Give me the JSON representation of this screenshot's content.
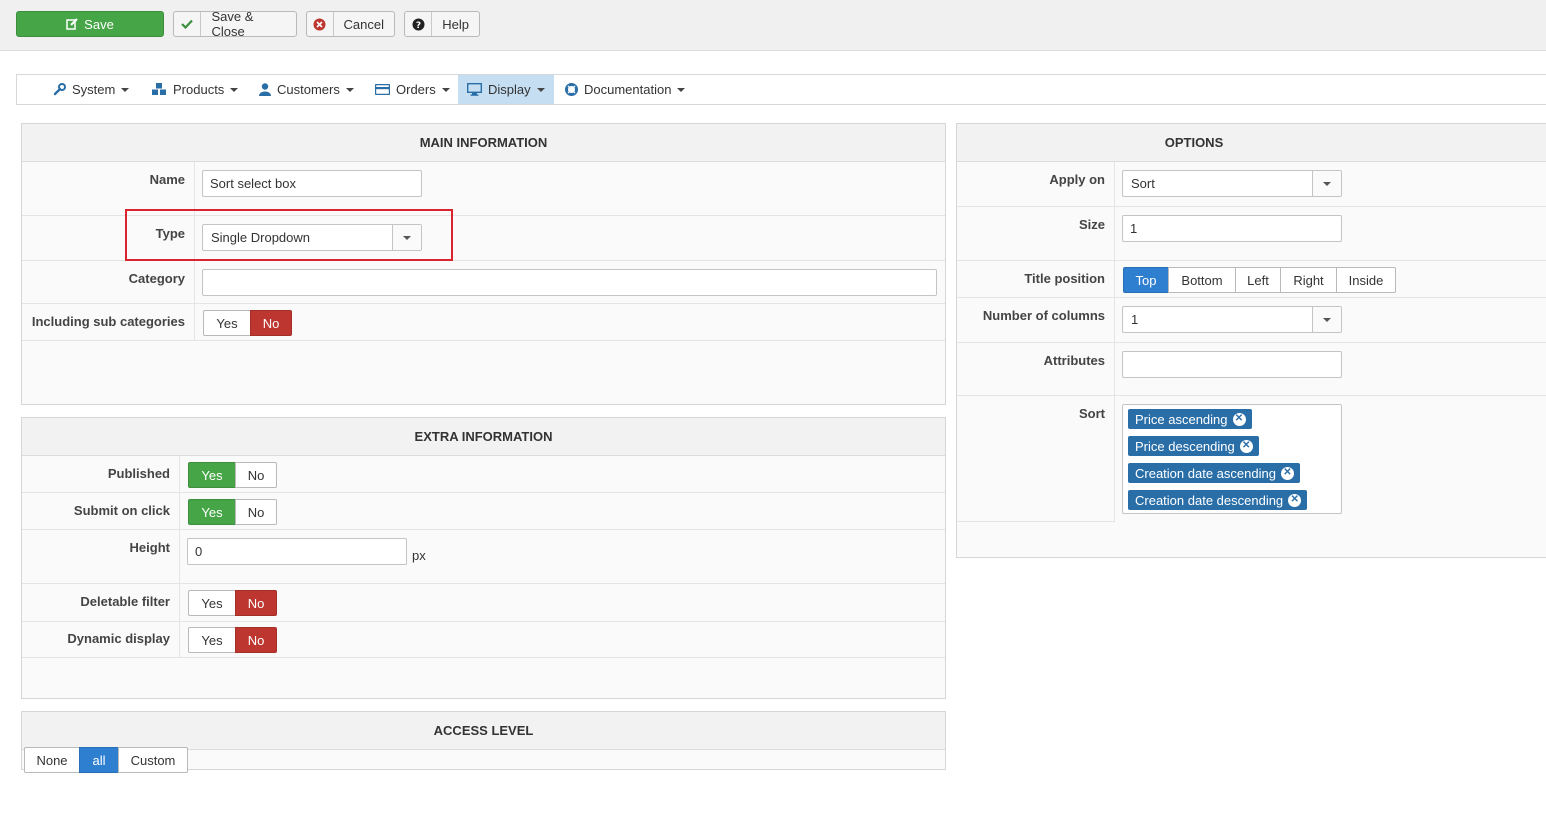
{
  "toolbar": {
    "save": "Save",
    "save_close": "Save & Close",
    "cancel": "Cancel",
    "help": "Help"
  },
  "nav": {
    "items": [
      "System",
      "Products",
      "Customers",
      "Orders",
      "Display",
      "Documentation"
    ],
    "active": "Display"
  },
  "main": {
    "title": "MAIN INFORMATION",
    "name_label": "Name",
    "name_value": "Sort select box",
    "type_label": "Type",
    "type_value": "Single Dropdown",
    "category_label": "Category",
    "category_value": "",
    "subcat_label": "Including sub categories",
    "subcat_yes": "Yes",
    "subcat_no": "No",
    "subcat_selected": "No"
  },
  "extra": {
    "title": "EXTRA INFORMATION",
    "published_label": "Published",
    "submit_label": "Submit on click",
    "height_label": "Height",
    "height_value": "0",
    "height_unit": "px",
    "deletable_label": "Deletable filter",
    "dynamic_label": "Dynamic display",
    "yes": "Yes",
    "no": "No",
    "published_selected": "Yes",
    "submit_selected": "Yes",
    "deletable_selected": "No",
    "dynamic_selected": "No"
  },
  "access": {
    "title": "ACCESS LEVEL",
    "options": [
      "None",
      "all",
      "Custom"
    ],
    "selected": "all"
  },
  "options": {
    "title": "OPTIONS",
    "apply_label": "Apply on",
    "apply_value": "Sort",
    "size_label": "Size",
    "size_value": "1",
    "title_pos_label": "Title position",
    "title_pos_options": [
      "Top",
      "Bottom",
      "Left",
      "Right",
      "Inside"
    ],
    "title_pos_selected": "Top",
    "columns_label": "Number of columns",
    "columns_value": "1",
    "attributes_label": "Attributes",
    "attributes_value": "",
    "sort_label": "Sort",
    "sort_tags": [
      "Price ascending",
      "Price descending",
      "Creation date ascending",
      "Creation date descending"
    ]
  },
  "colors": {
    "green": "#46a546",
    "red": "#bd362f",
    "blue": "#2f7fd1",
    "tag": "#2a6ea8",
    "highlight": "#d9232d",
    "nav_active": "#c6def2"
  }
}
